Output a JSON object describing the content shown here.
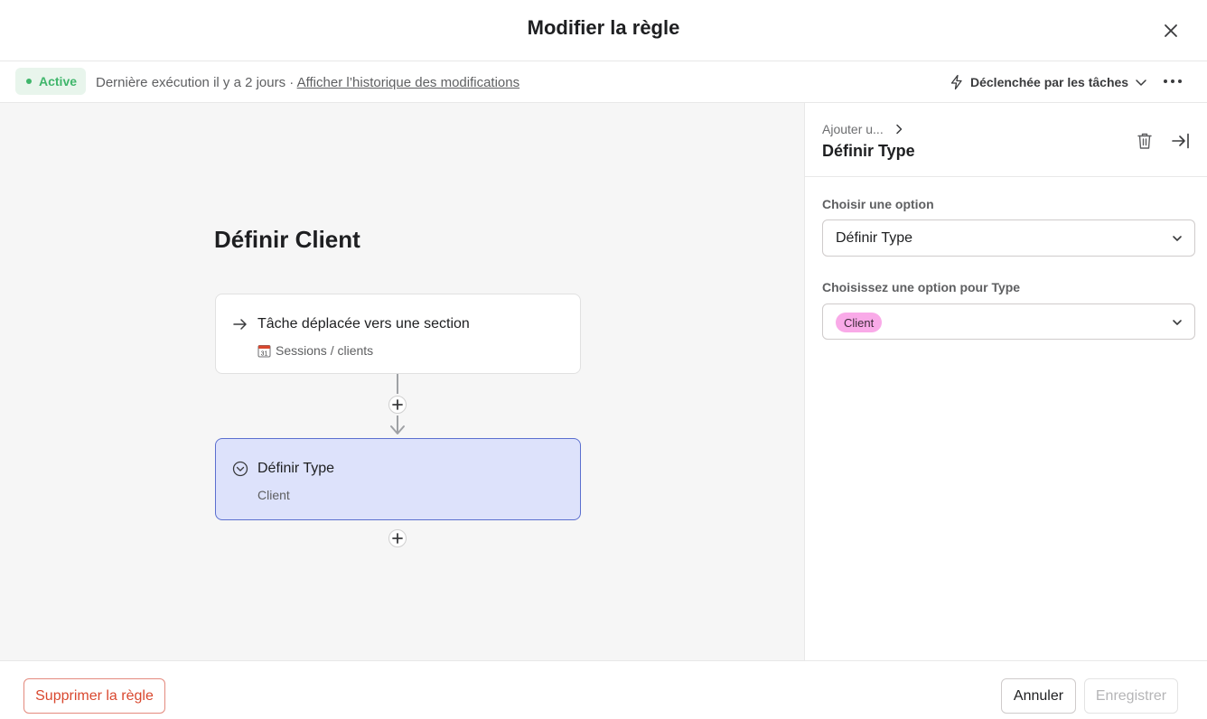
{
  "header": {
    "title": "Modifier la règle"
  },
  "statusbar": {
    "status": "Active",
    "last_run": "Dernière exécution il y a 2 jours ·",
    "history_link": "Afficher l’historique des modifications",
    "trigger_menu": "Déclenchée par les tâches"
  },
  "canvas": {
    "rule_title": "Définir Client",
    "trigger_card": {
      "title": "Tâche déplacée vers une section",
      "subtitle": "Sessions / clients"
    },
    "action_card": {
      "title": "Définir Type",
      "subtitle": "Client"
    }
  },
  "panel": {
    "breadcrumb": "Ajouter u...",
    "title": "Définir Type",
    "field1": {
      "label": "Choisir une option",
      "value": "Définir Type"
    },
    "field2": {
      "label": "Choisissez une option pour Type",
      "value": "Client"
    }
  },
  "footer": {
    "delete_label": "Supprimer la règle",
    "cancel_label": "Annuler",
    "save_label": "Enregistrer"
  },
  "colors": {
    "active_green": "#3fb66b",
    "action_card_bg": "#dde2fb",
    "action_card_border": "#5b6fcf",
    "pill_pink": "#f9aae8",
    "danger_red": "#d9482f"
  },
  "icons": {
    "close": "close-icon",
    "lightning": "lightning-icon",
    "more": "more-icon",
    "arrow_right": "arrow-right-icon",
    "calendar": "calendar-icon",
    "dropdown_circle": "dropdown-circle-icon",
    "plus": "plus-icon",
    "trash": "trash-icon",
    "collapse": "collapse-panel-icon",
    "chevron_down": "chevron-down-icon",
    "chevron_right": "chevron-right-icon"
  }
}
